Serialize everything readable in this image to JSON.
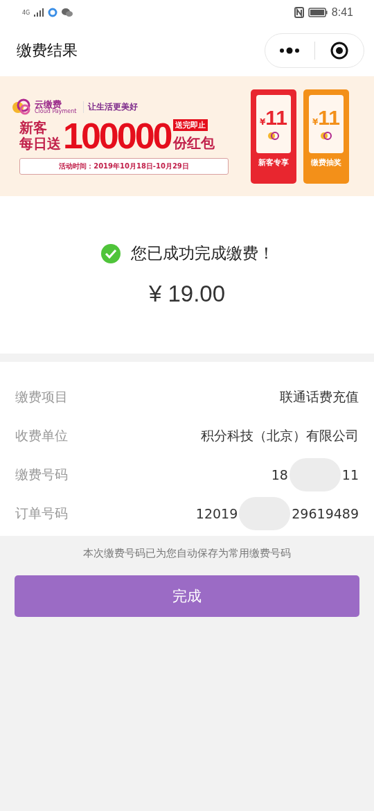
{
  "status_bar": {
    "network": "4G",
    "time": "8:41"
  },
  "nav": {
    "title": "缴费结果"
  },
  "banner": {
    "brand": "云缴费",
    "brand_en": "Cloud Payment",
    "slogan": "让生活更美好",
    "line1": "新客",
    "line2": "每日送",
    "big_number": "100000",
    "tag": "送完即止",
    "unit": "份红包",
    "period": "活动时间：2019年10月18日-10月29日",
    "coupons": [
      {
        "currency": "¥",
        "amount": "11",
        "label": "新客专享",
        "color": "#e8262f"
      },
      {
        "currency": "¥",
        "amount": "11",
        "label": "缴费抽奖",
        "color": "#f39019"
      }
    ]
  },
  "result": {
    "message": "您已成功完成缴费！",
    "amount": "¥ 19.00"
  },
  "details": [
    {
      "label": "缴费项目",
      "value_parts": [
        "联通话费充值"
      ]
    },
    {
      "label": "收费单位",
      "value_parts": [
        "积分科技（北京）有限公司"
      ]
    },
    {
      "label": "缴费号码",
      "value_parts": [
        "18",
        "11"
      ]
    },
    {
      "label": "订单号码",
      "value_parts": [
        "12019",
        "29619489"
      ]
    }
  ],
  "note": "本次缴费号码已为您自动保存为常用缴费号码",
  "button": "完成"
}
